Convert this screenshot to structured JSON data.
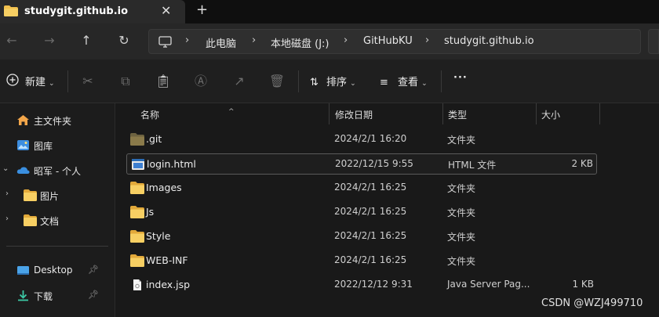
{
  "tab": {
    "title": "studygit.github.io",
    "close": "✕",
    "new_tab": "+"
  },
  "nav": {
    "back": "←",
    "forward": "→",
    "up": "↑",
    "refresh": "↻"
  },
  "breadcrumb": [
    "此电脑",
    "本地磁盘 (J:)",
    "GitHubKU",
    "studygit.github.io"
  ],
  "breadcrumb_separator": "›",
  "toolbar": {
    "new_label": "新建",
    "sort_label": "排序",
    "view_label": "查看",
    "more_label": "···"
  },
  "sidebar": {
    "items": [
      {
        "label": "主文件夹",
        "icon": "home-icon"
      },
      {
        "label": "图库",
        "icon": "gallery-icon"
      },
      {
        "label": "昭军 - 个人",
        "icon": "onedrive-icon"
      },
      {
        "label": "图片",
        "icon": "folder-icon"
      },
      {
        "label": "文档",
        "icon": "folder-icon"
      },
      {
        "label": "Desktop",
        "icon": "desktop-icon"
      },
      {
        "label": "下载",
        "icon": "download-icon"
      }
    ]
  },
  "columns": {
    "name": "名称",
    "date": "修改日期",
    "type": "类型",
    "size": "大小"
  },
  "files": [
    {
      "name": ".git",
      "date": "2024/2/1 16:20",
      "type": "文件夹",
      "size": "",
      "icon": "folder-icon"
    },
    {
      "name": "login.html",
      "date": "2022/12/15 9:55",
      "type": "HTML 文件",
      "size": "2 KB",
      "icon": "html-file-icon"
    },
    {
      "name": "Images",
      "date": "2024/2/1 16:25",
      "type": "文件夹",
      "size": "",
      "icon": "folder-icon"
    },
    {
      "name": "Js",
      "date": "2024/2/1 16:25",
      "type": "文件夹",
      "size": "",
      "icon": "folder-icon"
    },
    {
      "name": "Style",
      "date": "2024/2/1 16:25",
      "type": "文件夹",
      "size": "",
      "icon": "folder-icon"
    },
    {
      "name": "WEB-INF",
      "date": "2024/2/1 16:25",
      "type": "文件夹",
      "size": "",
      "icon": "folder-icon"
    },
    {
      "name": "index.jsp",
      "date": "2022/12/12 9:31",
      "type": "Java Server Pag...",
      "size": "1 KB",
      "icon": "jsp-file-icon"
    }
  ],
  "watermark": "CSDN @WZJ499710",
  "colors": {
    "folder": "#f2c14e",
    "git_folder": "#8a7a4a",
    "onedrive": "#3a8fe0",
    "desktop": "#4aa3e8",
    "download": "#3cc9a6"
  }
}
